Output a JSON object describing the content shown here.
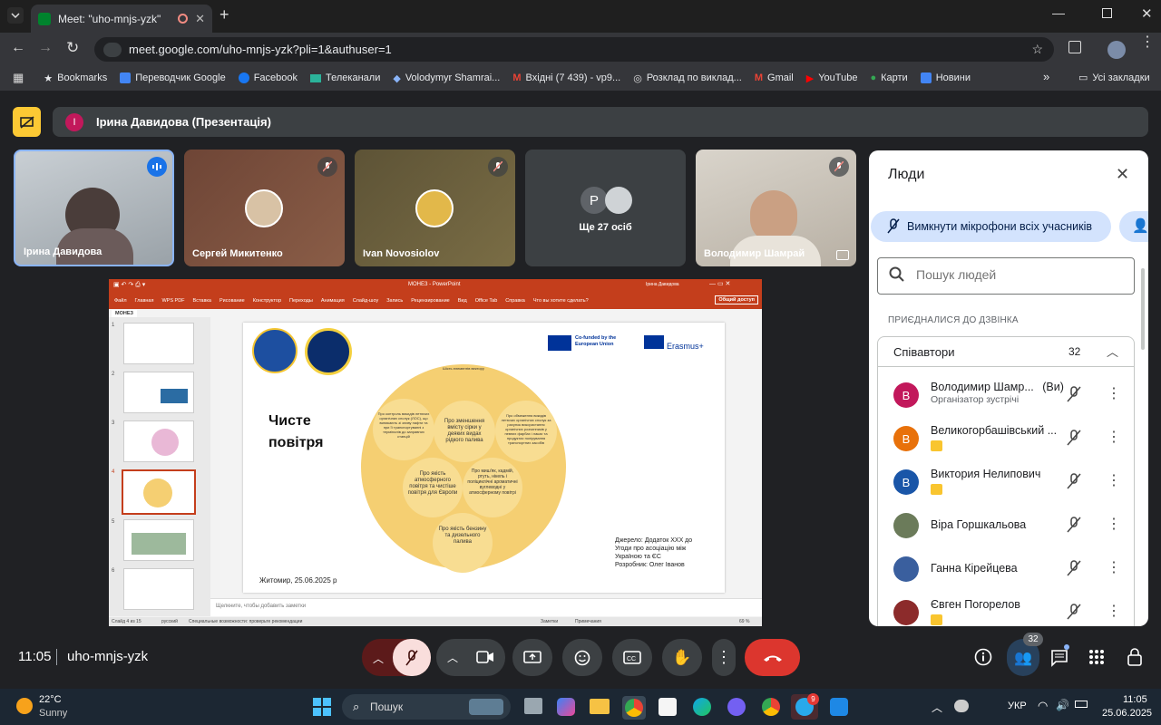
{
  "browser": {
    "tab_title": "Meet: \"uho-mnjs-yzk\"",
    "url": "meet.google.com/uho-mnjs-yzk?pli=1&authuser=1",
    "bookmarks": [
      "Bookmarks",
      "Переводчик Google",
      "Facebook",
      "Телеканали",
      "Volodymyr Shamrai...",
      "Вхідні (7 439) - vp9...",
      "Розклад по виклад...",
      "Gmail",
      "YouTube",
      "Карти",
      "Новини"
    ],
    "all_bookmarks": "Усі закладки"
  },
  "meet": {
    "presenter_initial": "І",
    "presenter_label": "Ірина Давидова (Презентація)",
    "tiles": [
      {
        "name": "Ірина Давидова"
      },
      {
        "name": "Сергей Микитенко"
      },
      {
        "name": "Ivan Novosiolov"
      },
      {
        "name": "Ще 27 осіб",
        "initial": "P"
      },
      {
        "name": "Володимир Шамрай"
      }
    ],
    "time": "11:05",
    "code": "uho-mnjs-yzk",
    "people_count": "32"
  },
  "ppt": {
    "title": "МОНЕЗ - PowerPoint",
    "user": "Ірина Давидова",
    "share": "Общий доступ",
    "file_tab": "МОНЕЗ",
    "menu": [
      "Файл",
      "Главная",
      "WPS PDF",
      "Вставка",
      "Рисование",
      "Конструктор",
      "Переходы",
      "Анимация",
      "Слайд-шоу",
      "Запись",
      "Рецензирование",
      "Вид",
      "Office Tab",
      "Справка",
      "Что вы хотите сделать?"
    ],
    "slide_nums": [
      "1",
      "2",
      "3",
      "4",
      "5",
      "6"
    ],
    "slide": {
      "title_line1": "Чисте",
      "title_line2": "повітря",
      "cofunded": "Co-funded by the European Union",
      "erasmus": "Erasmus+",
      "circle_top": "Шість елементів вектору",
      "bubbles": [
        "Про контроль викидів летючих органічних сполук (ЛОС), що виникають зі зливу нафти та при її транспортуванні з терміналів до заправних станцій",
        "Про зменшення вмісту сірки у деяких видах рідкого палива",
        "Про обмеження викидів летючих органічних сполук за рахунок використання органічних розчинників у певних фарбах і лаках та продуктах полірування транспортних засобів",
        "Про якість атмосферного повітря та чистіше повітря для Європи",
        "Про миш'як, кадмій, ртуть, нікель і поліциклічні ароматичні вуглеводні у атмосферному повітрі",
        "Про якість бензину та дизельного палива"
      ],
      "source": "Джерело: Додаток XXX до Угоди про асоціацію між Україною та ЄС",
      "author": "Розробник: Олег Іванов",
      "footer": "Житомир, 25.06.2025 р"
    },
    "notes": "Щелкните, чтобы добавить заметки",
    "status": {
      "slide": "Слайд 4 из 15",
      "lang": "русский",
      "access": "Специальные возможности: проверьте рекомендации",
      "notes": "Заметки",
      "comments": "Примечания",
      "zoom": "69 %"
    }
  },
  "people": {
    "title": "Люди",
    "mute_all": "Вимкнути мікрофони всіх учасників",
    "search_placeholder": "Пошук людей",
    "joined": "ПРИЄДНАЛИСЯ ДО ДЗВІНКА",
    "group": "Співавтори",
    "group_count": "32",
    "list": [
      {
        "initial": "В",
        "name": "Володимир Шамр...",
        "you": "(Ви)",
        "sub": "Організатор зустрічі",
        "color": "#c2185b"
      },
      {
        "initial": "В",
        "name": "Великогорбашівський ...",
        "color": "#e8710a"
      },
      {
        "initial": "В",
        "name": "Виктория Нелипович",
        "color": "#1a56a8"
      },
      {
        "name": "Віра Горшкальова",
        "color": "#6b7b5a"
      },
      {
        "name": "Ганна Кірейцева",
        "color": "#3a5f9e"
      },
      {
        "name": "Євген Погорелов",
        "color": "#8c2b2b"
      }
    ]
  },
  "taskbar": {
    "temp": "22°C",
    "weather": "Sunny",
    "search": "Пошук",
    "lang": "УКР",
    "time": "11:05",
    "date": "25.06.2025",
    "telegram_badge": "9"
  }
}
